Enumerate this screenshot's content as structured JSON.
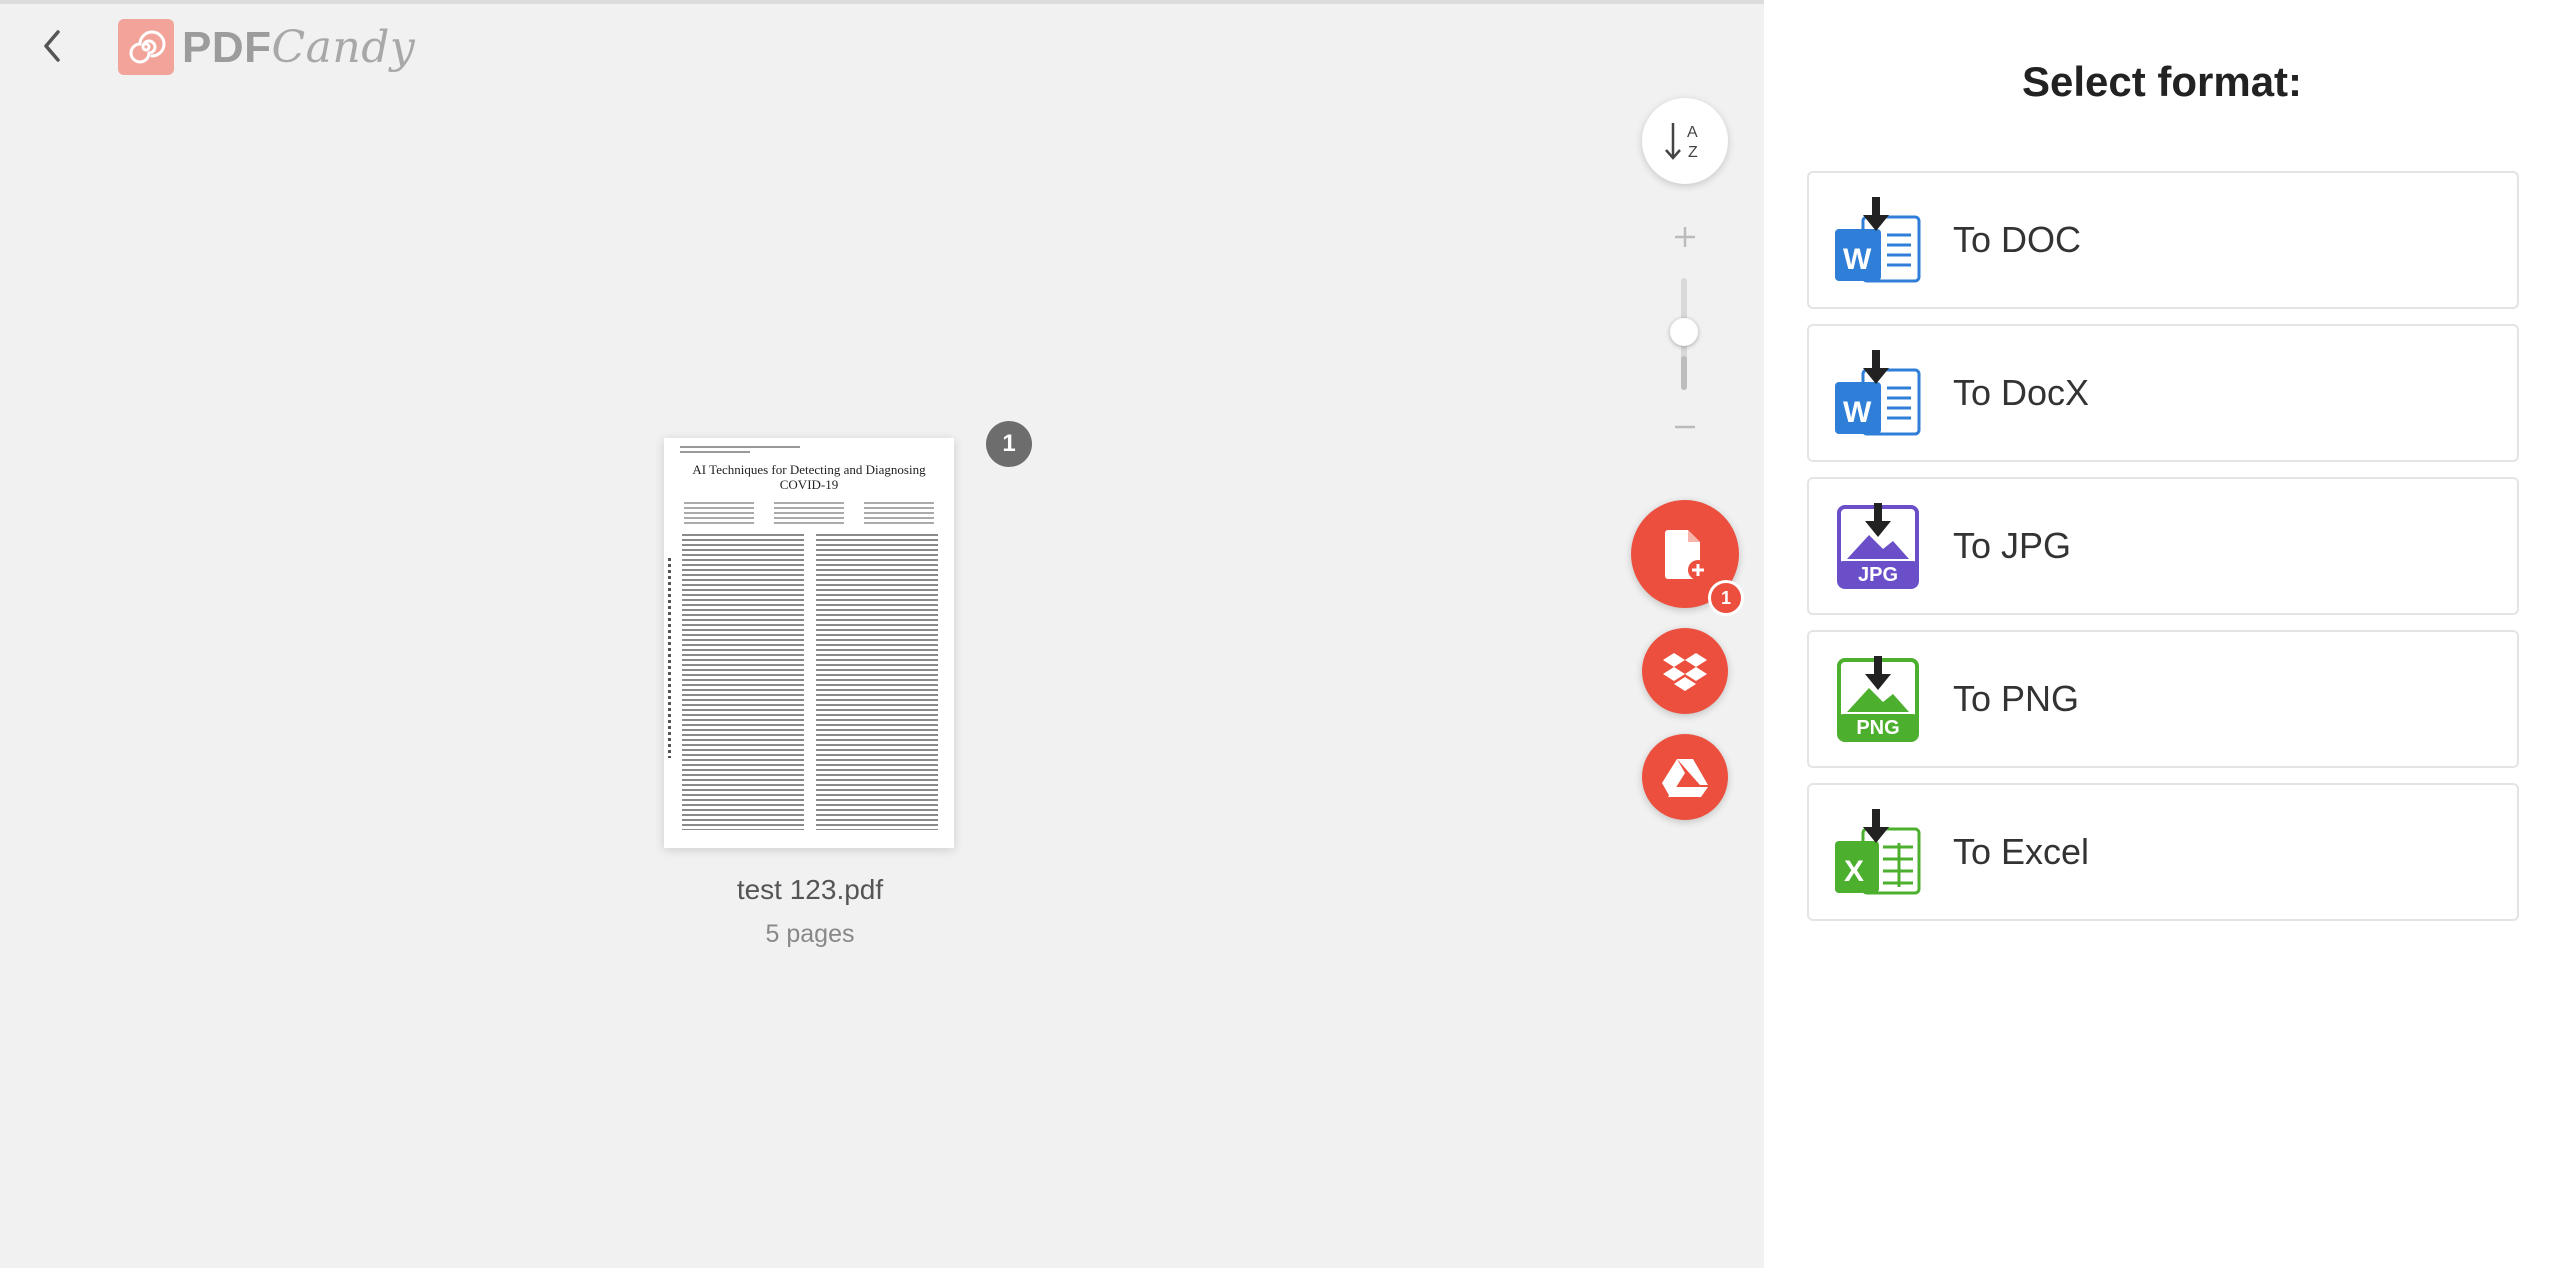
{
  "header": {
    "logo_pdf": "PDF",
    "logo_candy": "Candy"
  },
  "document": {
    "file_name": "test 123.pdf",
    "pages_label": "5 pages",
    "page_number": "1",
    "thumb_title_line1": "AI Techniques for Detecting and Diagnosing",
    "thumb_title_line2": "COVID-19"
  },
  "toolbar": {
    "add_badge_count": "1",
    "zoom_level": 0.3
  },
  "panel": {
    "title": "Select format:",
    "formats": [
      {
        "label": "To DOC",
        "icon": "word-doc-icon",
        "color": "#2f7ed8"
      },
      {
        "label": "To DocX",
        "icon": "word-docx-icon",
        "color": "#2f7ed8"
      },
      {
        "label": "To JPG",
        "icon": "jpg-icon",
        "color": "#6a4fc9",
        "tag": "JPG"
      },
      {
        "label": "To PNG",
        "icon": "png-icon",
        "color": "#4caf2e",
        "tag": "PNG"
      },
      {
        "label": "To Excel",
        "icon": "excel-icon",
        "color": "#4caf2e"
      }
    ]
  },
  "colors": {
    "accent": "#ec4f3e",
    "word": "#2f7ed8",
    "jpg": "#6a4fc9",
    "png": "#4caf2e",
    "excel": "#4caf2e"
  }
}
